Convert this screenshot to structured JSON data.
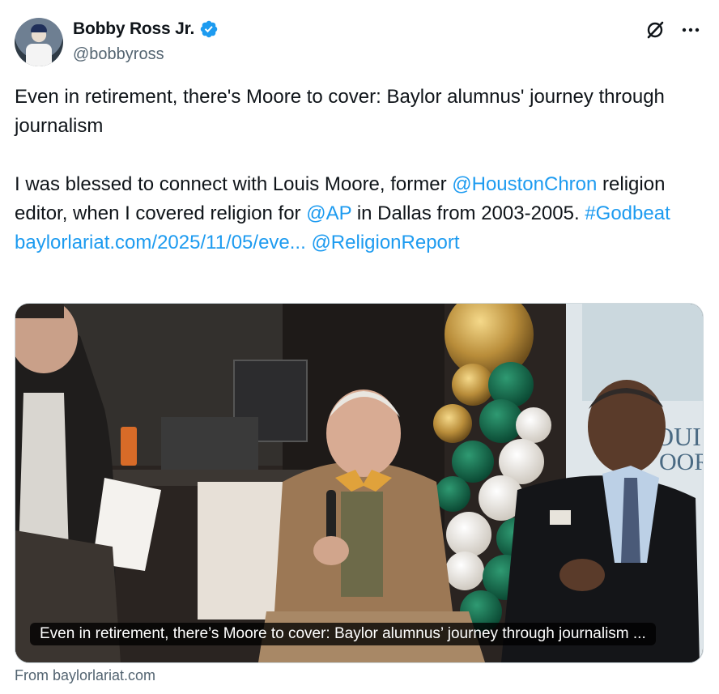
{
  "author": {
    "display_name": "Bobby Ross Jr.",
    "handle": "@bobbyross",
    "verified": true
  },
  "actions": {
    "grok_icon": "grok-icon",
    "more_icon": "more-icon"
  },
  "tweet": {
    "line1": "Even in retirement, there's Moore to cover: Baylor alumnus' journey through journalism",
    "p2_a": "I was blessed to connect with Louis Moore, former ",
    "mention_chron": "@HoustonChron",
    "p2_b": " religion editor, when I covered religion for ",
    "mention_ap": "@AP",
    "p2_c": " in Dallas from 2003-2005. ",
    "hashtag": "#Godbeat",
    "url": "baylorlariat.com/2025/11/05/eve...",
    "mention_religion": "@ReligionReport"
  },
  "card": {
    "caption": "Even in retirement, there’s Moore to cover: Baylor alumnus’ journey through journalism ...",
    "sign_text_1": "OUIS",
    "sign_text_2": "OOR"
  },
  "source": "From baylorlariat.com",
  "colors": {
    "link": "#1d9bf0",
    "verified": "#1d9bf0",
    "secondary": "#536471"
  }
}
